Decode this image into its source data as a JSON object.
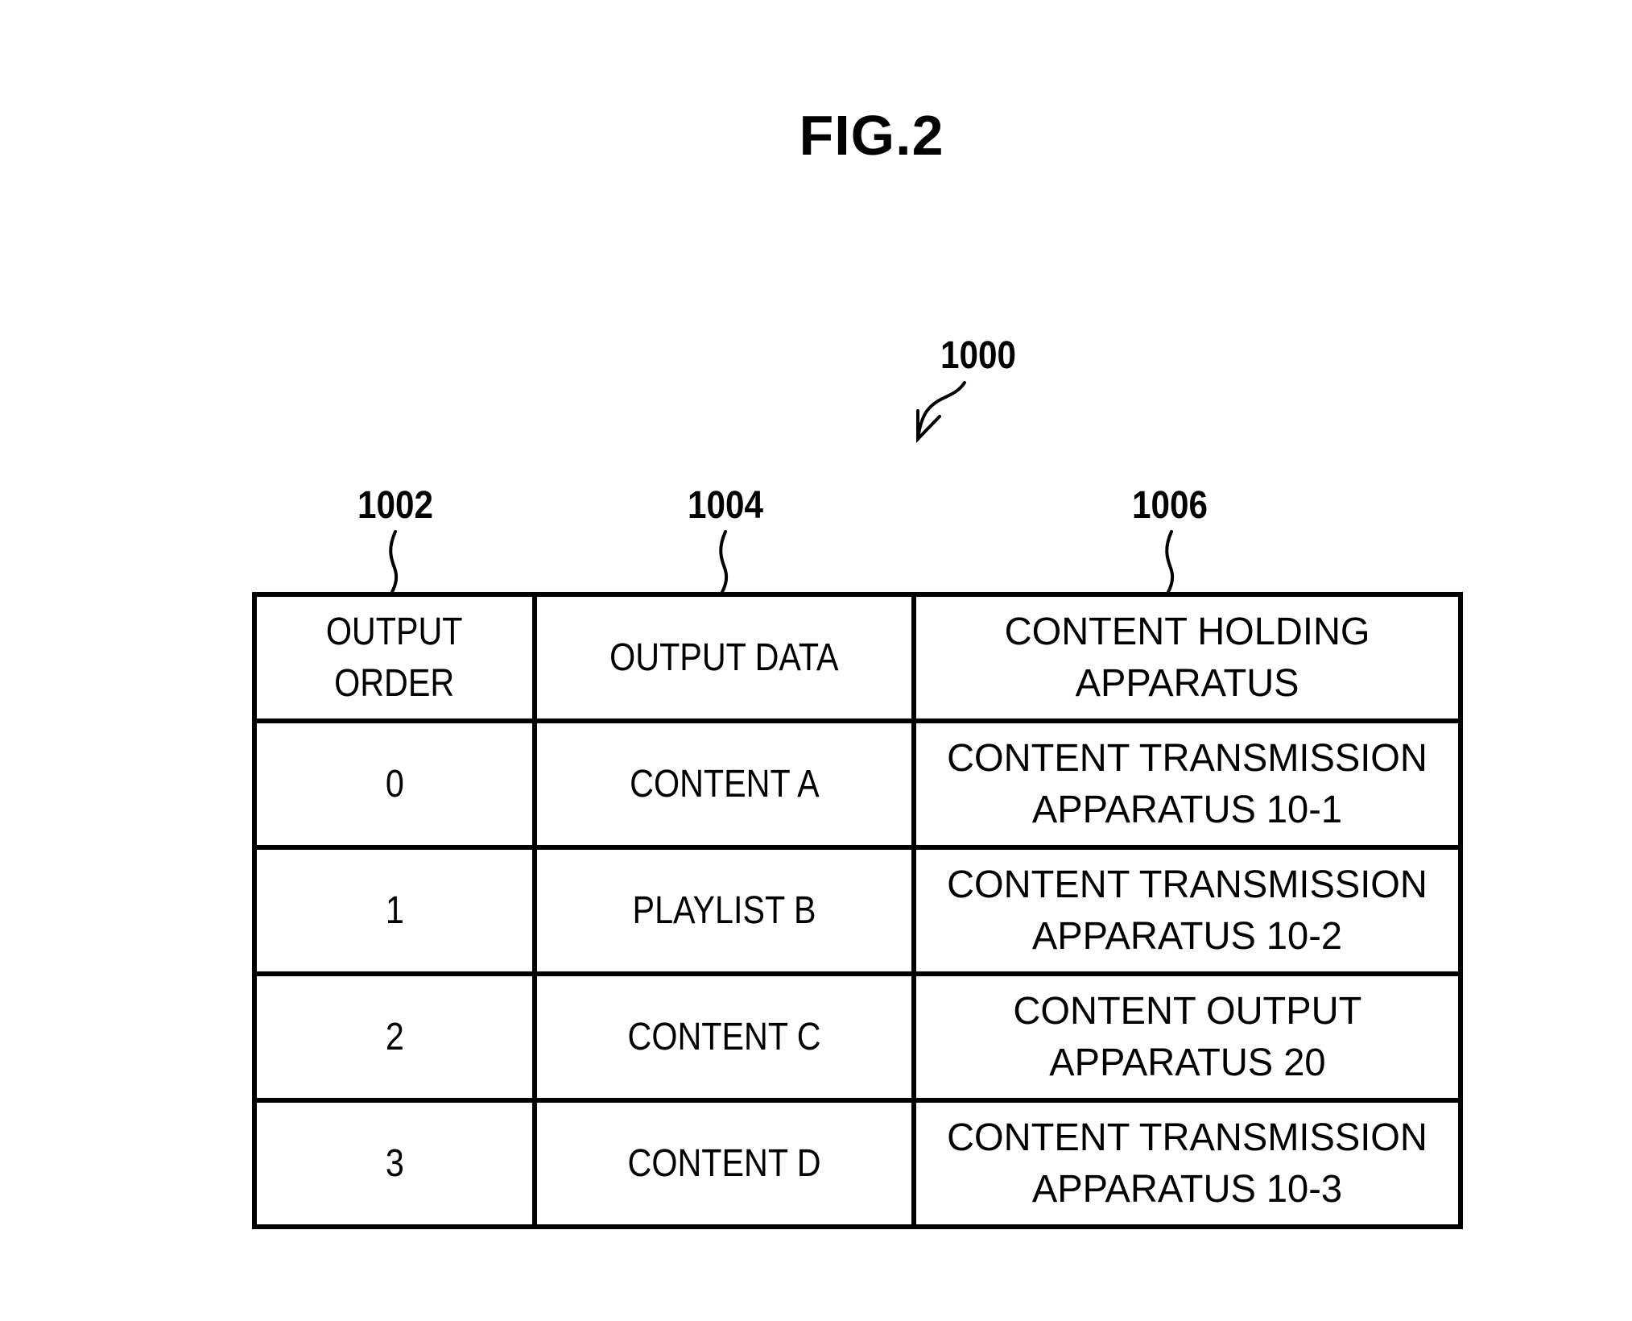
{
  "figure": {
    "title": "FIG.2",
    "table_ref": "1000",
    "column_refs": [
      "1002",
      "1004",
      "1006"
    ]
  },
  "table": {
    "headers": [
      [
        "OUTPUT",
        "ORDER"
      ],
      [
        "OUTPUT DATA"
      ],
      [
        "CONTENT HOLDING",
        "APPARATUS"
      ]
    ],
    "rows": [
      {
        "output_order": "0",
        "output_data": "CONTENT A",
        "holding_apparatus": [
          "CONTENT TRANSMISSION",
          "APPARATUS 10-1"
        ]
      },
      {
        "output_order": "1",
        "output_data": "PLAYLIST B",
        "holding_apparatus": [
          "CONTENT TRANSMISSION",
          "APPARATUS 10-2"
        ]
      },
      {
        "output_order": "2",
        "output_data": "CONTENT C",
        "holding_apparatus": [
          "CONTENT OUTPUT",
          "APPARATUS 20"
        ]
      },
      {
        "output_order": "3",
        "output_data": "CONTENT D",
        "holding_apparatus": [
          "CONTENT TRANSMISSION",
          "APPARATUS 10-3"
        ]
      }
    ]
  }
}
